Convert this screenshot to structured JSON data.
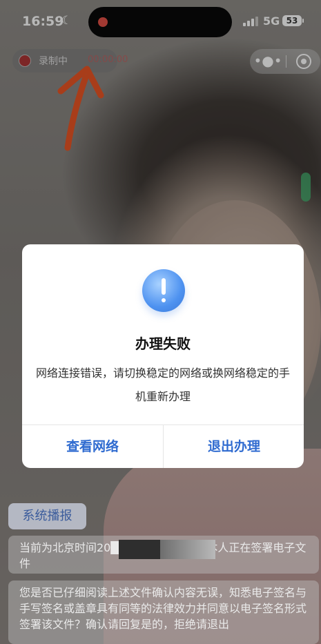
{
  "status_bar": {
    "time": "16:59",
    "network": "5G",
    "battery": "53"
  },
  "recording": {
    "label": "录制中",
    "time": "00:00:00"
  },
  "dialog": {
    "title": "办理失败",
    "message": "网络连接错误，请切换稳定的网络或换网络稳定的手机重新办理",
    "buttons": {
      "left": "查看网络",
      "right": "退出办理"
    }
  },
  "broadcast": {
    "tag": "系统播报",
    "message1": "当前为北京时间20██████████您本人正在签署电子文件",
    "message2": "您是否已仔细阅读上述文件确认内容无误，知悉电子签名与手写签名或盖章具有同等的法律效力并同意以电子签名形式签署该文件？确认请回复是的，拒绝请退出"
  },
  "colors": {
    "accent": "#2f6bd0",
    "record_dot": "#aa2f2f"
  },
  "icons": [
    "moon-icon",
    "signal-icon",
    "battery-icon",
    "record-dot-icon",
    "more-icon",
    "close-miniprogram-icon",
    "alert-icon",
    "annotation-arrow"
  ]
}
